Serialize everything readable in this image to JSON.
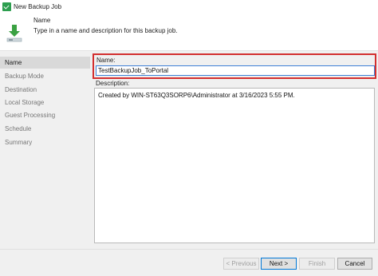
{
  "window": {
    "title": "New Backup Job",
    "accent_color": "#2d9e4f"
  },
  "header": {
    "title": "Name",
    "description": "Type in a name and description for this backup job.",
    "icon": "download-arrow-icon"
  },
  "sidebar": {
    "items": [
      {
        "label": "Name",
        "active": true
      },
      {
        "label": "Backup Mode",
        "active": false
      },
      {
        "label": "Destination",
        "active": false
      },
      {
        "label": "Local Storage",
        "active": false
      },
      {
        "label": "Guest Processing",
        "active": false
      },
      {
        "label": "Schedule",
        "active": false
      },
      {
        "label": "Summary",
        "active": false
      }
    ]
  },
  "form": {
    "name_label": "Name:",
    "name_value": "TestBackupJob_ToPortal",
    "description_label": "Description:",
    "description_value": "Created by WIN-ST63Q3SORP6\\Administrator at 3/16/2023 5:55 PM.",
    "highlight_color": "#d32f2f"
  },
  "footer": {
    "previous_label": "< Previous",
    "next_label": "Next >",
    "finish_label": "Finish",
    "cancel_label": "Cancel"
  }
}
